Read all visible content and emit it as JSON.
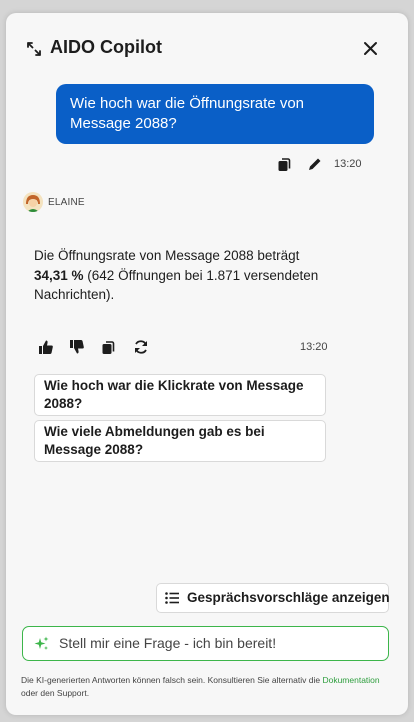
{
  "header": {
    "title": "AIDO Copilot",
    "expand_icon": "expand-icon",
    "close_icon": "close-icon"
  },
  "user_message": {
    "text": "Wie hoch war die Öffnungsrate von Message 2088?",
    "time": "13:20"
  },
  "agent": {
    "name": "ELAINE",
    "answer_prefix": "Die Öffnungsrate von Message 2088 beträgt ",
    "answer_bold": "34,31 %",
    "answer_suffix": " (642 Öffnungen bei 1.871 versendeten Nachrichten).",
    "time": "13:20"
  },
  "suggestions": [
    "Wie hoch war die Klickrate von Message 2088?",
    "Wie viele Abmeldungen gab es bei Message 2088?"
  ],
  "suggestions_button": "Gesprächsvorschläge anzeigen",
  "input": {
    "placeholder": "Stell mir eine Frage - ich bin bereit!"
  },
  "disclaimer": {
    "text_before": "Die KI-generierten Antworten können falsch sein. Konsultieren Sie alternativ die ",
    "link": "Dokumentation",
    "text_after": " oder den Support."
  },
  "colors": {
    "accent_blue": "#0a5fc7",
    "accent_green": "#3cb54a",
    "link_green": "#2e9e3e"
  }
}
